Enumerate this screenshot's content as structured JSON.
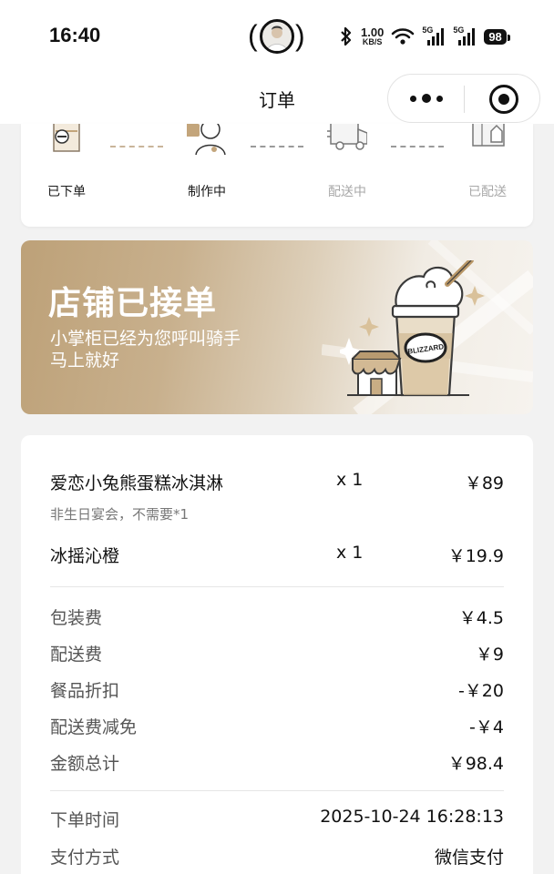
{
  "status_bar": {
    "time": "16:40",
    "net_speed_value": "1.00",
    "net_speed_unit": "KB/S",
    "signal_1": "5G",
    "signal_2": "5G",
    "battery": "98"
  },
  "nav": {
    "title": "订单"
  },
  "progress": {
    "steps": [
      {
        "label": "已下单",
        "state": "done"
      },
      {
        "label": "制作中",
        "state": "done"
      },
      {
        "label": "配送中",
        "state": "todo"
      },
      {
        "label": "已配送",
        "state": "todo"
      }
    ]
  },
  "banner": {
    "title": "店铺已接单",
    "subtitle_line1": "小掌柜已经为您呼叫骑手",
    "subtitle_line2": "马上就好",
    "cup_brand": "BLIZZARD"
  },
  "order": {
    "items": [
      {
        "name": "爱恋小兔熊蛋糕冰淇淋",
        "qty": "x 1",
        "price": "￥89",
        "note": "非生日宴会，不需要*1"
      },
      {
        "name": "冰摇沁橙",
        "qty": "x 1",
        "price": "￥19.9"
      }
    ],
    "fees": [
      {
        "label": "包装费",
        "value": "￥4.5"
      },
      {
        "label": "配送费",
        "value": "￥9"
      },
      {
        "label": "餐品折扣",
        "value": "-￥20"
      },
      {
        "label": "配送费减免",
        "value": "-￥4"
      },
      {
        "label": "金额总计",
        "value": "￥98.4"
      }
    ],
    "meta": [
      {
        "label": "下单时间",
        "value": "2025-10-24 16:28:13"
      },
      {
        "label": "支付方式",
        "value": "微信支付"
      }
    ]
  },
  "colors": {
    "accent_gold": "#c3a57b",
    "muted_text": "#a8a8a8"
  },
  "icons": [
    "bluetooth-icon",
    "wifi-icon",
    "signal-icon",
    "battery-icon",
    "more-icon",
    "target-icon",
    "order-bag-icon",
    "chef-icon",
    "delivery-truck-icon",
    "delivered-box-icon"
  ]
}
